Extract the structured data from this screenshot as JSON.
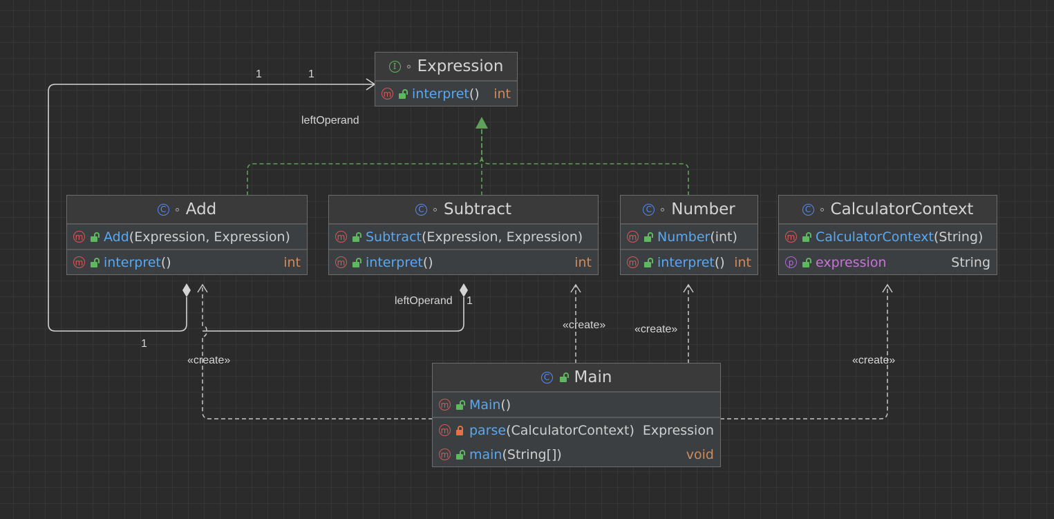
{
  "diagram": {
    "nodes": [
      {
        "id": "expression",
        "title": "Expression",
        "kind": "I",
        "kind_icon": "interface-icon",
        "visibility_icon": "package-private-dot-icon",
        "sections": [
          [
            {
              "kind": "m",
              "access": "public",
              "name": "interpret",
              "params": "()",
              "type": "int"
            }
          ]
        ]
      },
      {
        "id": "add",
        "title": "Add",
        "kind": "C",
        "kind_icon": "class-icon",
        "visibility_icon": "package-private-dot-icon",
        "sections": [
          [
            {
              "kind": "m",
              "access": "public",
              "name": "Add",
              "params": "(Expression, Expression)",
              "type": ""
            }
          ],
          [
            {
              "kind": "m",
              "access": "public",
              "name": "interpret",
              "params": "()",
              "type": "int"
            }
          ]
        ]
      },
      {
        "id": "subtract",
        "title": "Subtract",
        "kind": "C",
        "kind_icon": "class-icon",
        "visibility_icon": "package-private-dot-icon",
        "sections": [
          [
            {
              "kind": "m",
              "access": "public",
              "name": "Subtract",
              "params": "(Expression, Expression)",
              "type": ""
            }
          ],
          [
            {
              "kind": "m",
              "access": "public",
              "name": "interpret",
              "params": "()",
              "type": "int"
            }
          ]
        ]
      },
      {
        "id": "number",
        "title": "Number",
        "kind": "C",
        "kind_icon": "class-icon",
        "visibility_icon": "package-private-dot-icon",
        "sections": [
          [
            {
              "kind": "m",
              "access": "public",
              "name": "Number",
              "params": "(int)",
              "type": ""
            }
          ],
          [
            {
              "kind": "m",
              "access": "public",
              "name": "interpret",
              "params": "()",
              "type": "int"
            }
          ]
        ]
      },
      {
        "id": "calculatorcontext",
        "title": "CalculatorContext",
        "kind": "C",
        "kind_icon": "class-icon",
        "visibility_icon": "package-private-dot-icon",
        "sections": [
          [
            {
              "kind": "m",
              "access": "public",
              "name": "CalculatorContext",
              "params": "(String)",
              "type": ""
            }
          ],
          [
            {
              "kind": "p",
              "access": "public",
              "name": "expression",
              "params": "",
              "type": "String"
            }
          ]
        ]
      },
      {
        "id": "main",
        "title": "Main",
        "kind": "C",
        "kind_icon": "class-icon",
        "visibility_icon": "public-lock-icon",
        "sections": [
          [
            {
              "kind": "m",
              "access": "public",
              "name": "Main",
              "params": "()",
              "type": ""
            }
          ],
          [
            {
              "kind": "m",
              "access": "private",
              "name": "parse",
              "params": "(CalculatorContext)",
              "type": "Expression"
            },
            {
              "kind": "m",
              "access": "public",
              "name": "main",
              "params": "(String[])",
              "type": "void"
            }
          ]
        ]
      }
    ],
    "edge_labels": {
      "assoc_one_a": "1",
      "assoc_one_b": "1",
      "left_operand_top": "leftOperand",
      "left_operand_bottom": "leftOperand",
      "sub_mult": "1",
      "add_mult": "1",
      "create_add": "«create»",
      "create_subtract": "«create»",
      "create_number": "«create»",
      "create_context": "«create»"
    },
    "colors": {
      "background": "#2b2b2b",
      "grid": "#363636",
      "realization_edge": "#5fa05a",
      "association_edge": "#d4d4d4",
      "dependency_edge": "#c8c8c8",
      "method_name": "#5aa8f0",
      "property_name": "#c674d6",
      "type_text": "#d08a5c"
    }
  }
}
